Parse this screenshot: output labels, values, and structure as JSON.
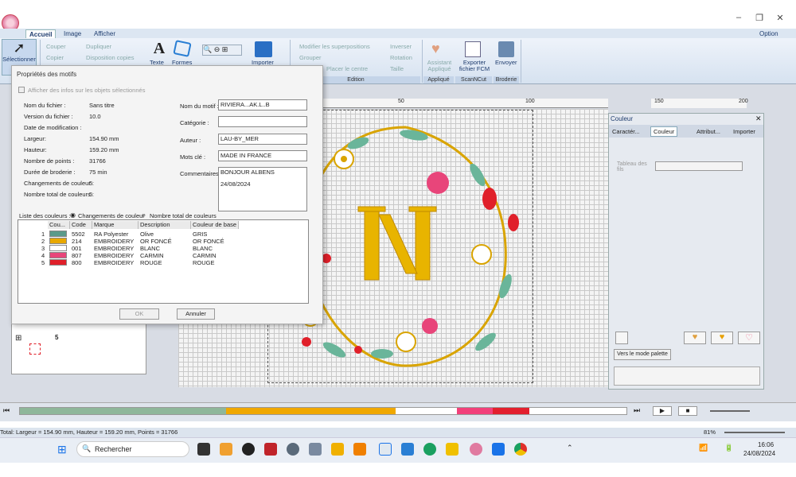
{
  "window": {
    "option_label": "Option"
  },
  "ribbon": {
    "tabs": [
      "Accueil",
      "Image",
      "Afficher"
    ],
    "select_label": "Sélectionner",
    "cut": "Couper",
    "copy": "Copier",
    "duplicate": "Dupliquer",
    "multi_copy": "Disposition copies",
    "text": "Texte",
    "forms": "Formes",
    "import": "Importer",
    "modify_overlaps": "Modifier les superpositions",
    "group": "Grouper",
    "merge": "Placer le centre",
    "invert": "Inverser",
    "rotation": "Rotation",
    "size": "Taille",
    "assistant": "Assistant Appliqué",
    "export": "Exporter fichier FCM",
    "send": "Envoyer",
    "group_edition": "Edition",
    "group_applique": "Appliqué",
    "group_scancut": "ScanNCut",
    "group_embroidery": "Broderie"
  },
  "ruler": {
    "labels": [
      "50",
      "100",
      "150",
      "200"
    ]
  },
  "dialog": {
    "title": "Propriétés des motifs",
    "show_info_check": "Afficher des infos sur les objets sélectionnés",
    "info": [
      {
        "label": "Nom du fichier :",
        "value": "Sans titre"
      },
      {
        "label": "Version du fichier :",
        "value": "10.0"
      },
      {
        "label": "Date de modification :",
        "value": ""
      },
      {
        "label": "Largeur:",
        "value": "154.90 mm"
      },
      {
        "label": "Hauteur:",
        "value": "159.20 mm"
      },
      {
        "label": "Nombre de points :",
        "value": "31766"
      },
      {
        "label": "Durée de broderie :",
        "value": "75 min"
      },
      {
        "label": "Changements de couleur :",
        "value": "5"
      },
      {
        "label": "Nombre total de couleurs :",
        "value": "5"
      }
    ],
    "motif_name_label": "Nom du motif :",
    "motif_name_value": "RIVIERA...AK.L..B",
    "category_label": "Catégorie :",
    "category_value": "",
    "author_label": "Auteur :",
    "author_value": "LAU-BY_MER",
    "keywords_label": "Mots clé :",
    "keywords_value": "MADE IN FRANCE",
    "comments_label": "Commentaires :",
    "comments_line1": "BONJOUR ALBENS",
    "comments_line2": "24/08/2024",
    "color_list_label": "Liste des couleurs :",
    "radio_changes": "Changements de couleur",
    "radio_total": "Nombre total de couleurs",
    "table_headers": [
      "Cou...",
      "Code",
      "Marque",
      "Description",
      "Couleur de base"
    ],
    "rows": [
      {
        "num": "1",
        "color": "#5a9a8a",
        "code": "5502",
        "brand": "RA Polyester",
        "desc": "Olive",
        "base": "GRIS"
      },
      {
        "num": "2",
        "color": "#e8a800",
        "code": "214",
        "brand": "EMBROIDERY",
        "desc": "OR FONCÉ",
        "base": "OR FONCÉ"
      },
      {
        "num": "3",
        "color": "#ffffff",
        "code": "001",
        "brand": "EMBROIDERY",
        "desc": "BLANC",
        "base": "BLANC"
      },
      {
        "num": "4",
        "color": "#e8457a",
        "code": "807",
        "brand": "EMBROIDERY",
        "desc": "CARMIN",
        "base": "CARMIN"
      },
      {
        "num": "5",
        "color": "#e0202a",
        "code": "800",
        "brand": "EMBROIDERY",
        "desc": "ROUGE",
        "base": "ROUGE"
      }
    ],
    "ok": "OK",
    "cancel": "Annuler"
  },
  "rpanel": {
    "title": "Couleur",
    "tabs": [
      "Caractér...",
      "Couleur",
      "Attribut...",
      "Importer"
    ],
    "palette_label": "Tableau des fils",
    "palette_button": "Vers le mode palette"
  },
  "leftpanel": {
    "number": "5"
  },
  "statusbar": {
    "text": "Total: Largeur = 154.90 mm, Hauteur = 159.20 mm, Points = 31766",
    "zoom": "81%"
  },
  "colorbar_segments": [
    {
      "color": "#8fb79a",
      "frac": 0.34
    },
    {
      "color": "#f0a800",
      "frac": 0.28
    },
    {
      "color": "#ffffff",
      "frac": 0.1
    },
    {
      "color": "#f2407a",
      "frac": 0.06
    },
    {
      "color": "#e3202e",
      "frac": 0.06
    }
  ],
  "taskbar": {
    "search": "Rechercher",
    "time": "16:06",
    "date": "24/08/2024"
  }
}
